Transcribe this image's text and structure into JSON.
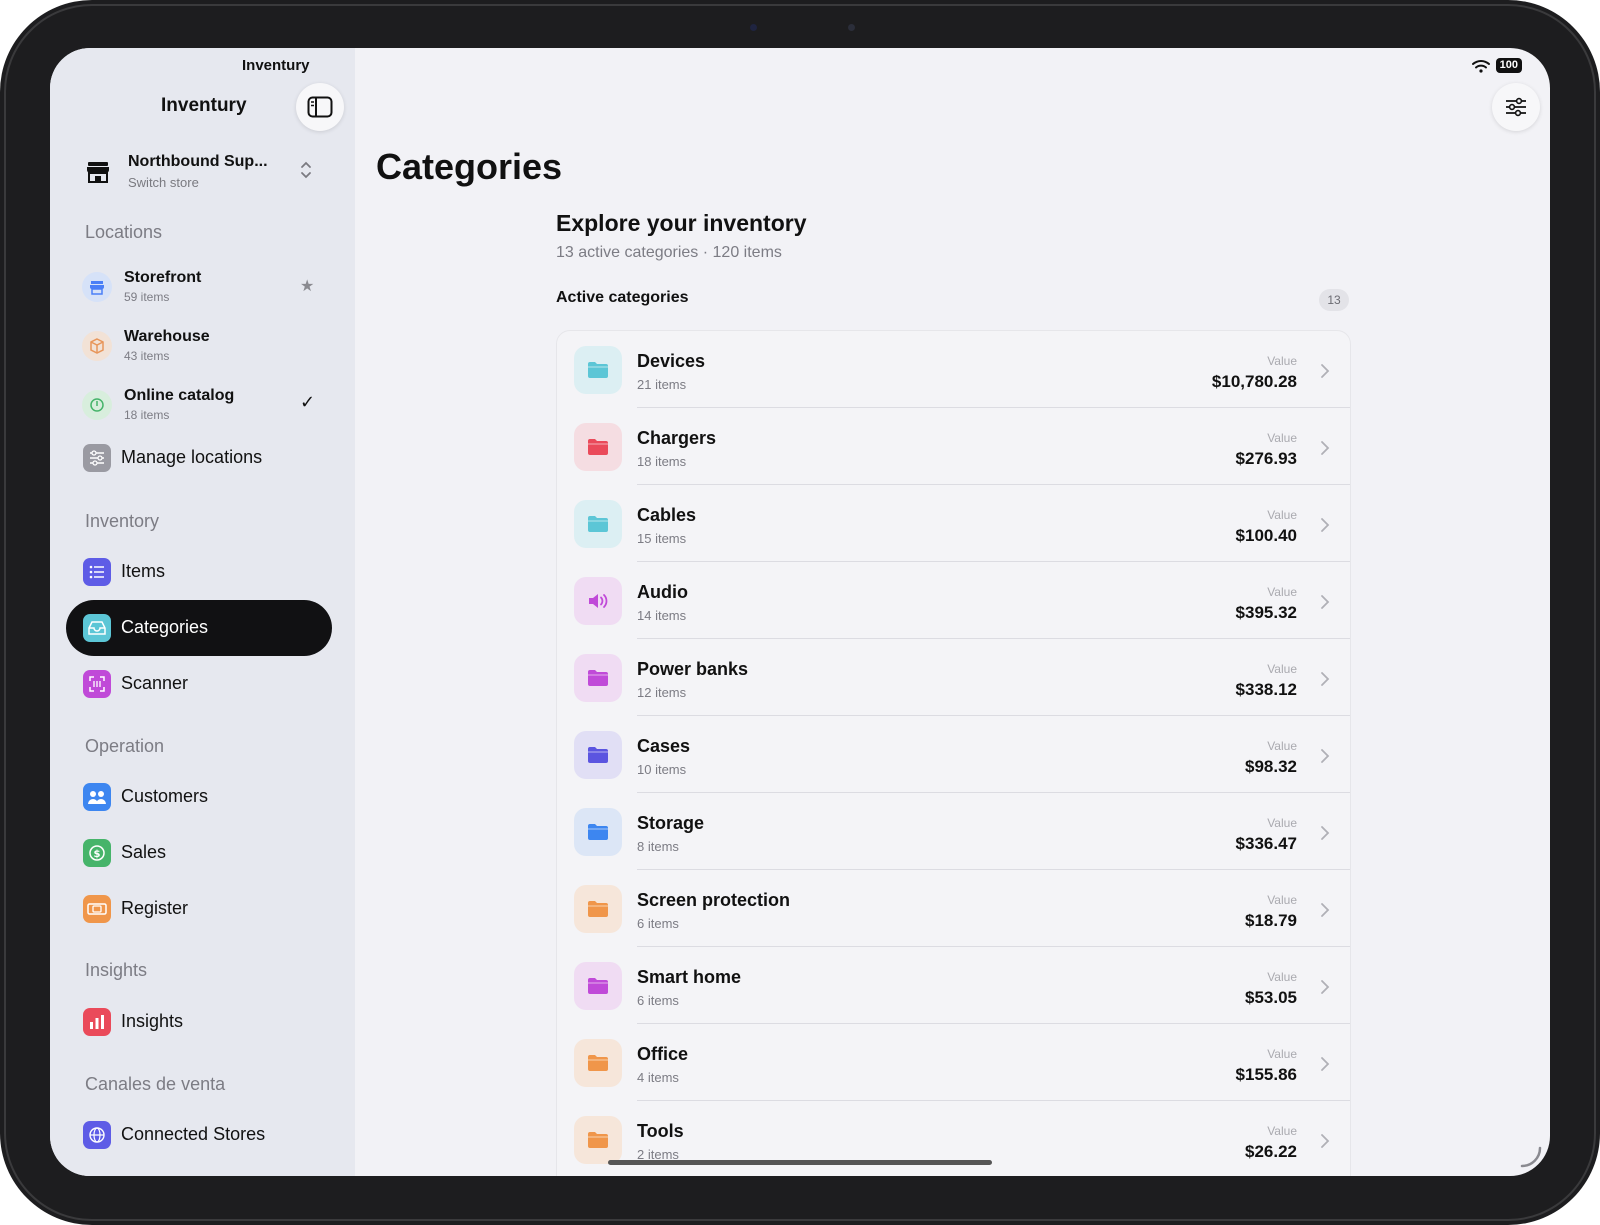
{
  "app": {
    "top_title": "Inventury",
    "title": "Inventury"
  },
  "store": {
    "name": "Northbound Sup...",
    "sub": "Switch store"
  },
  "sections": {
    "locations": "Locations",
    "inventory": "Inventory",
    "operation": "Operation",
    "insights": "Insights",
    "channels": "Canales de venta"
  },
  "locations": [
    {
      "name": "Storefront",
      "count": "59 items",
      "mark": "★",
      "color": "#4a7ff7"
    },
    {
      "name": "Warehouse",
      "count": "43 items",
      "mark": "",
      "color": "#e8965a"
    },
    {
      "name": "Online catalog",
      "count": "18 items",
      "mark": "✓",
      "color": "#46b46a"
    }
  ],
  "manage_locations": "Manage locations",
  "nav": {
    "items": "Items",
    "categories": "Categories",
    "scanner": "Scanner",
    "customers": "Customers",
    "sales": "Sales",
    "register": "Register",
    "insights": "Insights",
    "connected_stores": "Connected Stores"
  },
  "status": {
    "battery": "100"
  },
  "main": {
    "title": "Categories",
    "explore_title": "Explore your inventory",
    "explore_sub": "13 active categories · 120 items",
    "active_heading": "Active categories",
    "active_count": "13",
    "value_label": "Value"
  },
  "categories": [
    {
      "name": "Devices",
      "count": "21 items",
      "value": "$10,780.28",
      "icon": "folder-icon",
      "color": "#5cc6d6",
      "bg": "#dcefF3"
    },
    {
      "name": "Chargers",
      "count": "18 items",
      "value": "$276.93",
      "icon": "folder-icon",
      "color": "#ea4a5a",
      "bg": "#f5dde2"
    },
    {
      "name": "Cables",
      "count": "15 items",
      "value": "$100.40",
      "icon": "folder-icon",
      "color": "#5cc6d6",
      "bg": "#dcefF3"
    },
    {
      "name": "Audio",
      "count": "14 items",
      "value": "$395.32",
      "icon": "speaker-icon",
      "color": "#c04ad8",
      "bg": "#f0dcf3"
    },
    {
      "name": "Power banks",
      "count": "12 items",
      "value": "$338.12",
      "icon": "folder-icon",
      "color": "#c04ad8",
      "bg": "#f0dcf3"
    },
    {
      "name": "Cases",
      "count": "10 items",
      "value": "$98.32",
      "icon": "folder-icon",
      "color": "#5b55e0",
      "bg": "#e1dff5"
    },
    {
      "name": "Storage",
      "count": "8 items",
      "value": "$336.47",
      "icon": "folder-icon",
      "color": "#3d86f0",
      "bg": "#dce6f6"
    },
    {
      "name": "Screen protection",
      "count": "6 items",
      "value": "$18.79",
      "icon": "folder-icon",
      "color": "#f0964a",
      "bg": "#f6e6da"
    },
    {
      "name": "Smart home",
      "count": "6 items",
      "value": "$53.05",
      "icon": "folder-icon",
      "color": "#c04ad8",
      "bg": "#f0dcf3"
    },
    {
      "name": "Office",
      "count": "4 items",
      "value": "$155.86",
      "icon": "folder-icon",
      "color": "#f0964a",
      "bg": "#f6e6da"
    },
    {
      "name": "Tools",
      "count": "2 items",
      "value": "$26.22",
      "icon": "folder-icon",
      "color": "#f0964a",
      "bg": "#f6e6da"
    }
  ]
}
